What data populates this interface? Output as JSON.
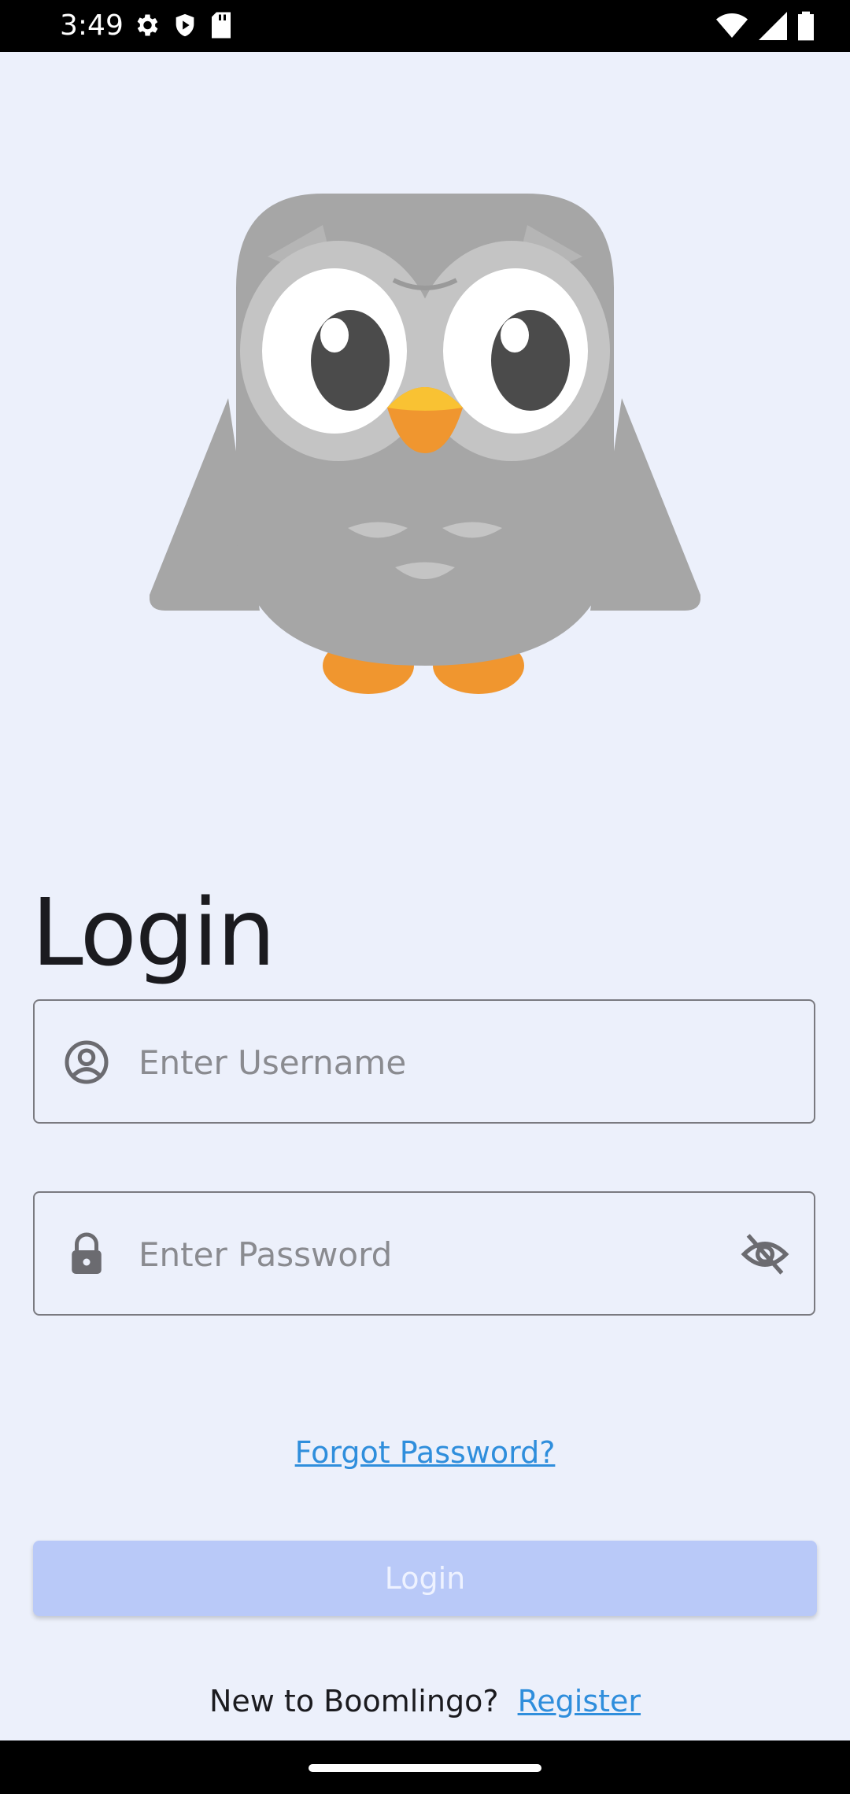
{
  "status_bar": {
    "time": "3:49",
    "left_icons": [
      "gear-icon",
      "shield-play-icon",
      "sd-card-icon"
    ],
    "right_icons": [
      "wifi-icon",
      "signal-icon",
      "battery-icon"
    ]
  },
  "mascot": {
    "icon": "owl-mascot"
  },
  "login": {
    "title": "Login",
    "username_placeholder": "Enter Username",
    "password_placeholder": "Enter Password",
    "forgot_password": "Forgot Password?",
    "login_button": "Login",
    "new_user_text": "New to Boomlingo?",
    "register_link": "Register"
  },
  "colors": {
    "background": "#ecf0fb",
    "button_disabled": "#b9c9f8",
    "link": "#2f8edc"
  }
}
